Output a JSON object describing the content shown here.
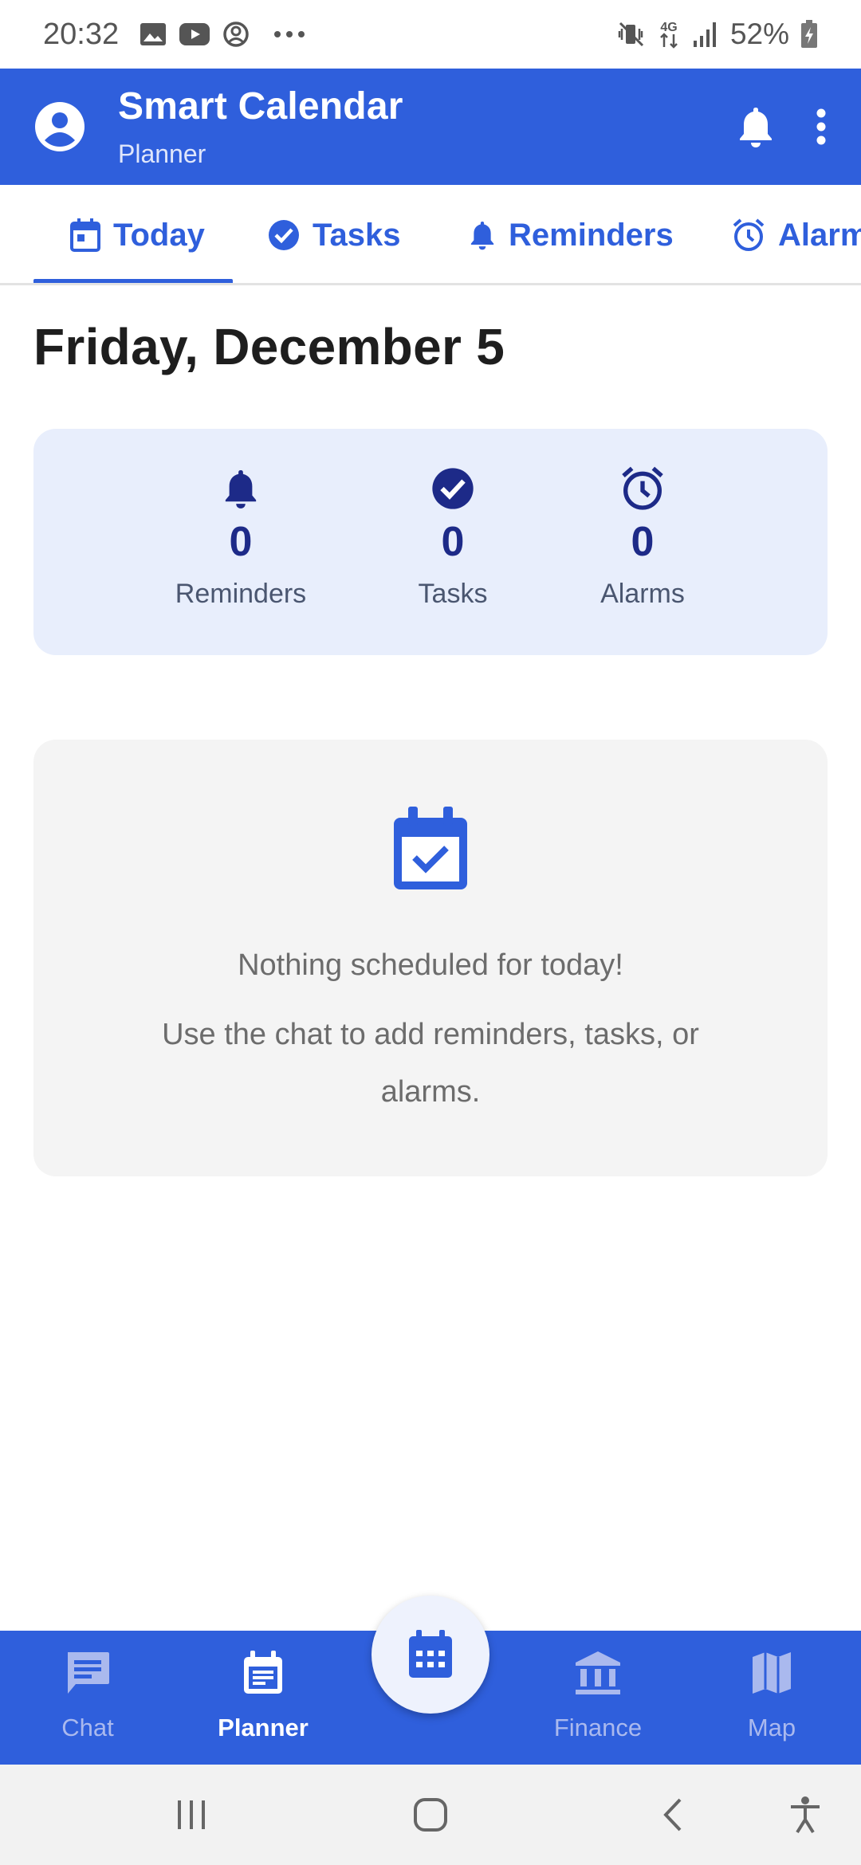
{
  "status_bar": {
    "time": "20:32",
    "battery": "52%",
    "left_icons": [
      "image-icon",
      "youtube-icon",
      "account-circle-icon",
      "more-dots-icon"
    ],
    "right_icons": [
      "vibrate-mute-icon",
      "network-4g-icon",
      "signal-icon",
      "battery-charging-icon"
    ]
  },
  "app_bar": {
    "title": "Smart Calendar",
    "subtitle": "Planner",
    "background": "#2f5fdc"
  },
  "tabs": [
    {
      "label": "Today",
      "icon": "calendar-today-icon",
      "selected": true
    },
    {
      "label": "Tasks",
      "icon": "check-circle-icon",
      "selected": false
    },
    {
      "label": "Reminders",
      "icon": "bell-icon",
      "selected": false
    },
    {
      "label": "Alarms",
      "icon": "alarm-clock-icon",
      "selected": false
    }
  ],
  "date_heading": "Friday, December 5",
  "summary": [
    {
      "count": "0",
      "label": "Reminders",
      "icon": "bell-icon"
    },
    {
      "count": "0",
      "label": "Tasks",
      "icon": "check-circle-icon"
    },
    {
      "count": "0",
      "label": "Alarms",
      "icon": "alarm-clock-icon"
    }
  ],
  "empty_state": {
    "icon": "calendar-check-icon",
    "line1": "Nothing scheduled for today!",
    "line2": "Use the chat to add reminders, tasks, or alarms."
  },
  "bottom_nav": [
    {
      "label": "Chat",
      "icon": "chat-icon",
      "active": false
    },
    {
      "label": "Planner",
      "icon": "planner-icon",
      "active": true
    },
    {
      "label": "Finance",
      "icon": "bank-icon",
      "active": false
    },
    {
      "label": "Map",
      "icon": "map-icon",
      "active": false
    }
  ],
  "fab_icon": "calendar-month-icon",
  "colors": {
    "primary": "#2f5fdc",
    "summary_card": "#e8eefc",
    "summary_accent": "#1d2a88",
    "empty_card": "#f4f4f4"
  }
}
